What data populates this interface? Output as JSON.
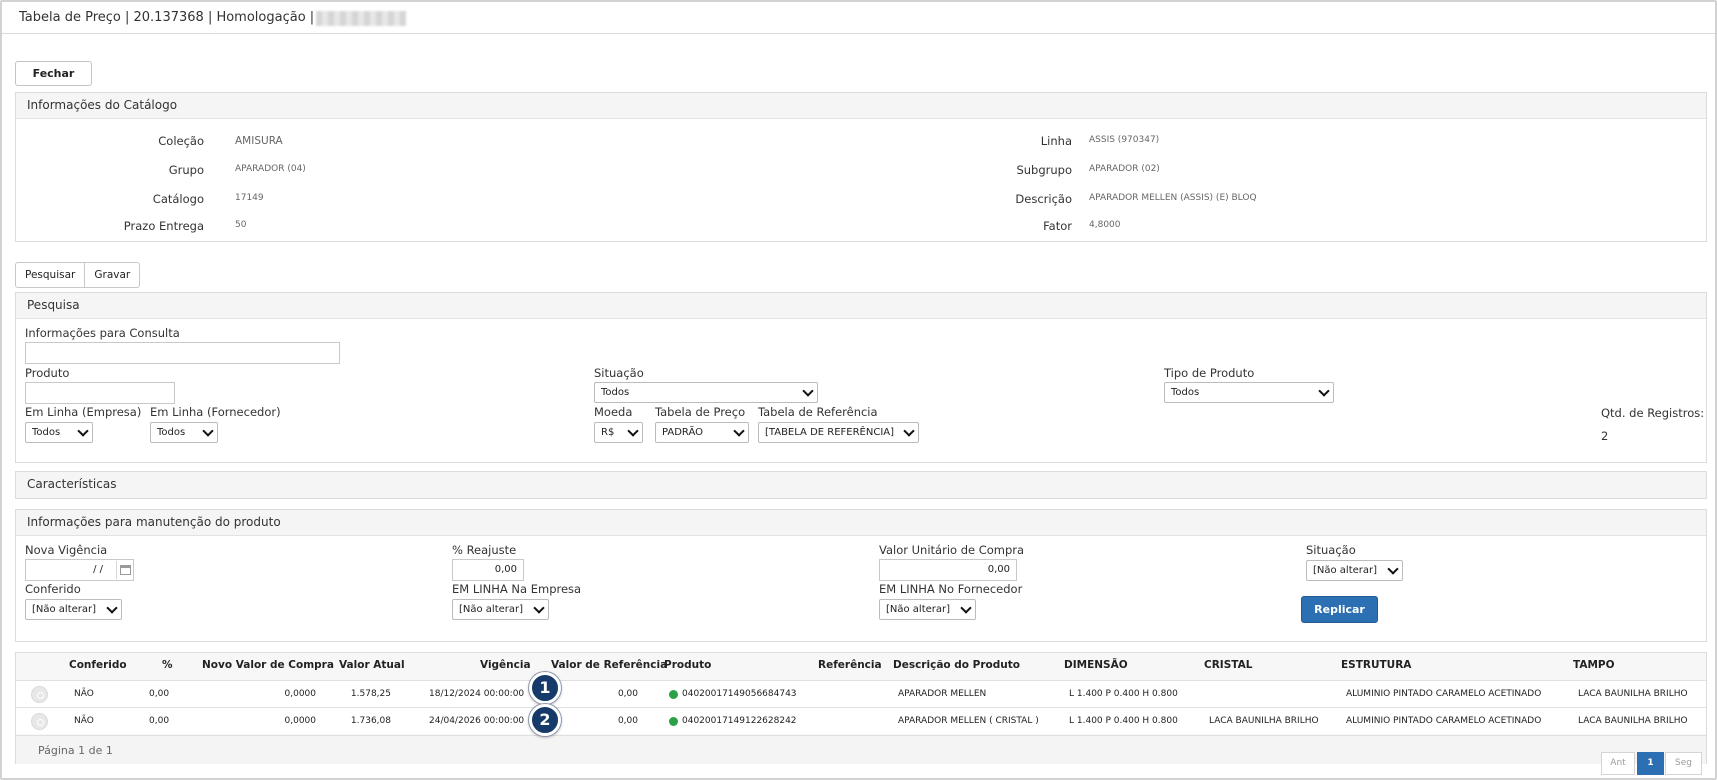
{
  "window": {
    "title": "Tabela de Preço | 20.137368 | Homologação |"
  },
  "actions": {
    "close_label": "Fechar"
  },
  "catalog": {
    "header": "Informações do Catálogo",
    "left": [
      {
        "label": "Coleção",
        "value": "AMISURA"
      },
      {
        "label": "Grupo",
        "value": "APARADOR (04)"
      },
      {
        "label": "Catálogo",
        "value": "17149"
      },
      {
        "label": "Prazo Entrega",
        "value": "50"
      }
    ],
    "right": [
      {
        "label": "Linha",
        "value": "ASSIS (970347)"
      },
      {
        "label": "Subgrupo",
        "value": "APARADOR (02)"
      },
      {
        "label": "Descrição",
        "value": "APARADOR MELLEN (ASSIS) (E) BLOQ"
      },
      {
        "label": "Fator",
        "value": "4,8000"
      }
    ]
  },
  "tabs": [
    "Pesquisar",
    "Gravar"
  ],
  "search": {
    "header": "Pesquisa",
    "info_label": "Informações para Consulta",
    "info_value": "",
    "product_label": "Produto",
    "product_value": "",
    "situacao_label": "Situação",
    "situacao_value": "Todos",
    "tipo_label": "Tipo de Produto",
    "tipo_value": "Todos",
    "em_linha_empresa_label": "Em Linha (Empresa)",
    "em_linha_empresa_value": "Todos",
    "em_linha_fornecedor_label": "Em Linha (Fornecedor)",
    "em_linha_fornecedor_value": "Todos",
    "moeda_label": "Moeda",
    "moeda_value": "R$",
    "tabela_preco_label": "Tabela de Preço",
    "tabela_preco_value": "PADRÃO",
    "tabela_ref_label": "Tabela de Referência",
    "tabela_ref_value": "[TABELA DE REFERÊNCIA]",
    "qtd_label": "Qtd. de Registros:",
    "qtd_value": "2"
  },
  "caracteristicas": {
    "header": "Características"
  },
  "maintenance": {
    "header": "Informações para manutenção do produto",
    "nova_vigencia_label": "Nova Vigência",
    "nova_vigencia_value": "/ /",
    "reajuste_label": "% Reajuste",
    "reajuste_value": "0,00",
    "valor_compra_label": "Valor Unitário de Compra",
    "valor_compra_value": "0,00",
    "situacao_label": "Situação",
    "situacao_value": "[Não alterar]",
    "conferido_label": "Conferido",
    "conferido_value": "[Não alterar]",
    "em_linha_empresa_label": "EM LINHA Na Empresa",
    "em_linha_empresa_value": "[Não alterar]",
    "em_linha_fornecedor_label": "EM LINHA No Fornecedor",
    "em_linha_fornecedor_value": "[Não alterar]",
    "replicar_label": "Replicar"
  },
  "grid": {
    "columns": [
      "Conferido",
      "%",
      "Novo Valor de Compra",
      "Valor Atual",
      "Vigência",
      "Valor de Referência",
      "Produto",
      "Referência",
      "Descrição do Produto",
      "DIMENSÃO",
      "CRISTAL",
      "ESTRUTURA",
      "TAMPO"
    ],
    "rows": [
      {
        "badge": "1",
        "conferido": "NÃO",
        "pct": "0,00",
        "novo_valor": "0,0000",
        "valor_atual": "1.578,25",
        "vigencia": "18/12/2024 00:00:00",
        "valor_ref": "0,00",
        "produto": "04020017149056684743",
        "referencia": "",
        "descricao": "APARADOR MELLEN",
        "dimensao": "L 1.400 P 0.400 H 0.800",
        "cristal": "",
        "estrutura": "ALUMINIO PINTADO CARAMELO ACETINADO",
        "tampo": "LACA BAUNILHA BRILHO",
        "status_color": "#2aa147"
      },
      {
        "badge": "2",
        "conferido": "NÃO",
        "pct": "0,00",
        "novo_valor": "0,0000",
        "valor_atual": "1.736,08",
        "vigencia": "24/04/2026 00:00:00",
        "valor_ref": "0,00",
        "produto": "04020017149122628242",
        "referencia": "",
        "descricao": "APARADOR MELLEN ( CRISTAL )",
        "dimensao": "L 1.400 P 0.400 H 0.800",
        "cristal": "LACA BAUNILHA BRILHO",
        "estrutura": "ALUMINIO PINTADO CARAMELO ACETINADO",
        "tampo": "LACA BAUNILHA BRILHO",
        "status_color": "#2aa147"
      }
    ],
    "footer": "Página 1 de 1",
    "pager": {
      "prev": "Ant",
      "current": "1",
      "next": "Seg"
    }
  },
  "colors": {
    "primary": "#2d6fb3",
    "badge": "#163a6a",
    "status_ok": "#2aa147"
  }
}
